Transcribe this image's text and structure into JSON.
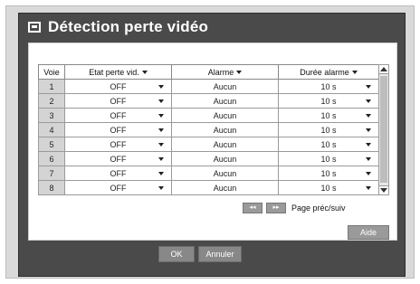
{
  "window": {
    "title": "Détection perte vidéo",
    "icon": "monitor-icon"
  },
  "table": {
    "headers": [
      "Voie",
      "Etat perte vid.",
      "Alarme",
      "Durée alarme"
    ],
    "rows": [
      {
        "voie": "1",
        "etat": "OFF",
        "alarme": "Aucun",
        "duree": "10 s"
      },
      {
        "voie": "2",
        "etat": "OFF",
        "alarme": "Aucun",
        "duree": "10 s"
      },
      {
        "voie": "3",
        "etat": "OFF",
        "alarme": "Aucun",
        "duree": "10 s"
      },
      {
        "voie": "4",
        "etat": "OFF",
        "alarme": "Aucun",
        "duree": "10 s"
      },
      {
        "voie": "5",
        "etat": "OFF",
        "alarme": "Aucun",
        "duree": "10 s"
      },
      {
        "voie": "6",
        "etat": "OFF",
        "alarme": "Aucun",
        "duree": "10 s"
      },
      {
        "voie": "7",
        "etat": "OFF",
        "alarme": "Aucun",
        "duree": "10 s"
      },
      {
        "voie": "8",
        "etat": "OFF",
        "alarme": "Aucun",
        "duree": "10 s"
      }
    ]
  },
  "pager": {
    "prev_label": "◂◂",
    "next_label": "▸▸",
    "label": "Page préc/suiv"
  },
  "buttons": {
    "aide": "Aide",
    "ok": "OK",
    "annuler": "Annuler"
  },
  "colors": {
    "window_bg": "#4a4a4a",
    "index_bg": "#d4d4d4",
    "button_bg": "#9a9a9a"
  }
}
